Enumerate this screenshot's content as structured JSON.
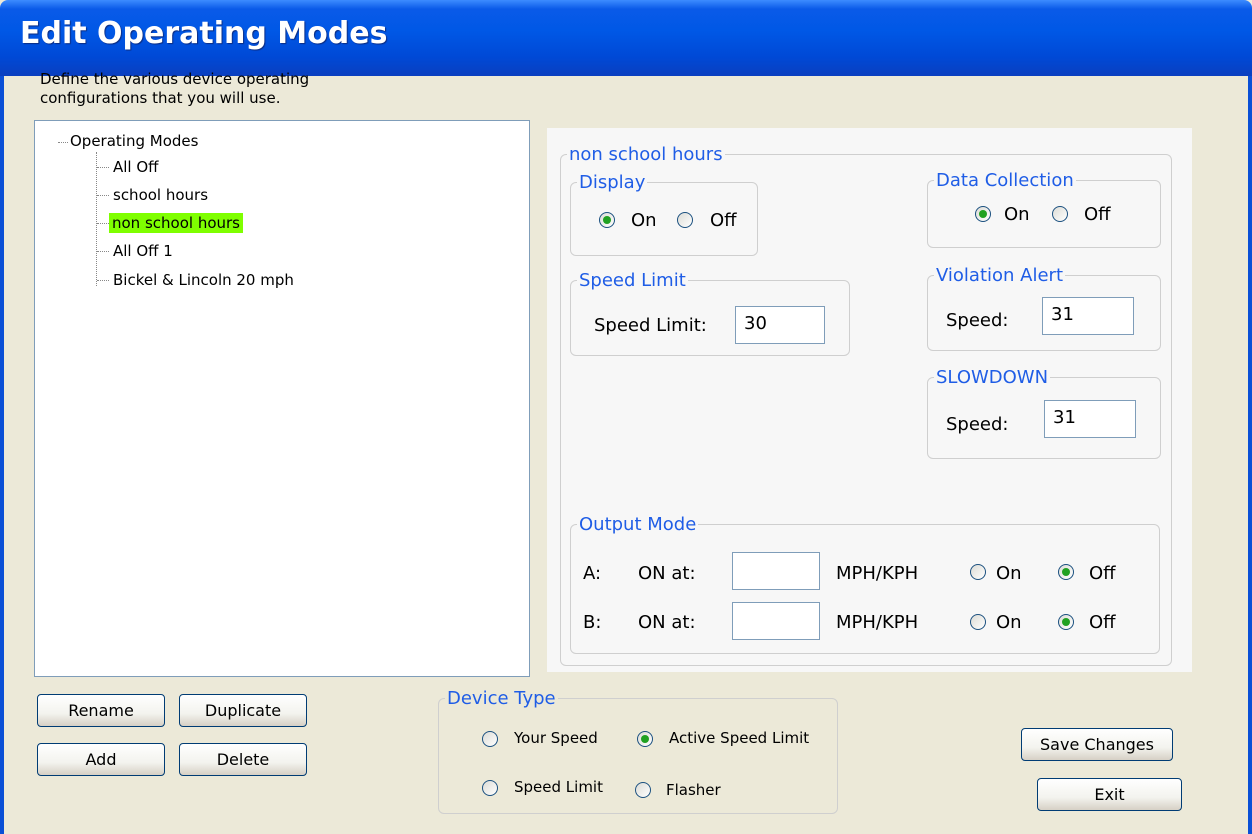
{
  "window": {
    "title": "Edit Operating Modes"
  },
  "intro": {
    "line1": "Define the various device operating",
    "line2": "configurations that you will use."
  },
  "tree": {
    "root": "Operating Modes",
    "items": [
      {
        "label": "All Off"
      },
      {
        "label": "school hours"
      },
      {
        "label": "non school hours",
        "selected": true
      },
      {
        "label": "All Off 1"
      },
      {
        "label": "Bickel & Lincoln 20 mph"
      }
    ],
    "selected_color": "#7fff00"
  },
  "mode_panel": {
    "title": "non school hours",
    "display": {
      "legend": "Display",
      "on": "On",
      "off": "Off",
      "value": "On"
    },
    "data_collection": {
      "legend": "Data Collection",
      "on": "On",
      "off": "Off",
      "value": "On"
    },
    "speed_limit": {
      "legend": "Speed Limit",
      "label": "Speed Limit:",
      "value": "30"
    },
    "violation_alert": {
      "legend": "Violation Alert",
      "label": "Speed:",
      "value": "31"
    },
    "slowdown": {
      "legend": "SLOWDOWN",
      "label": "Speed:",
      "value": "31"
    },
    "output_mode": {
      "legend": "Output Mode",
      "rows": [
        {
          "label": "A:",
          "on_at": "ON at:",
          "value": "",
          "unit": "MPH/KPH",
          "on": "On",
          "off": "Off",
          "state": "Off"
        },
        {
          "label": "B:",
          "on_at": "ON at:",
          "value": "",
          "unit": "MPH/KPH",
          "on": "On",
          "off": "Off",
          "state": "Off"
        }
      ]
    },
    "legend_color": "#1f5de6"
  },
  "buttons": {
    "rename": "Rename",
    "duplicate": "Duplicate",
    "add": "Add",
    "delete": "Delete",
    "save": "Save Changes",
    "exit": "Exit"
  },
  "device_type": {
    "legend": "Device Type",
    "options": [
      "Your Speed",
      "Active Speed Limit",
      "Speed Limit",
      "Flasher"
    ],
    "selected": "Active Speed Limit"
  }
}
